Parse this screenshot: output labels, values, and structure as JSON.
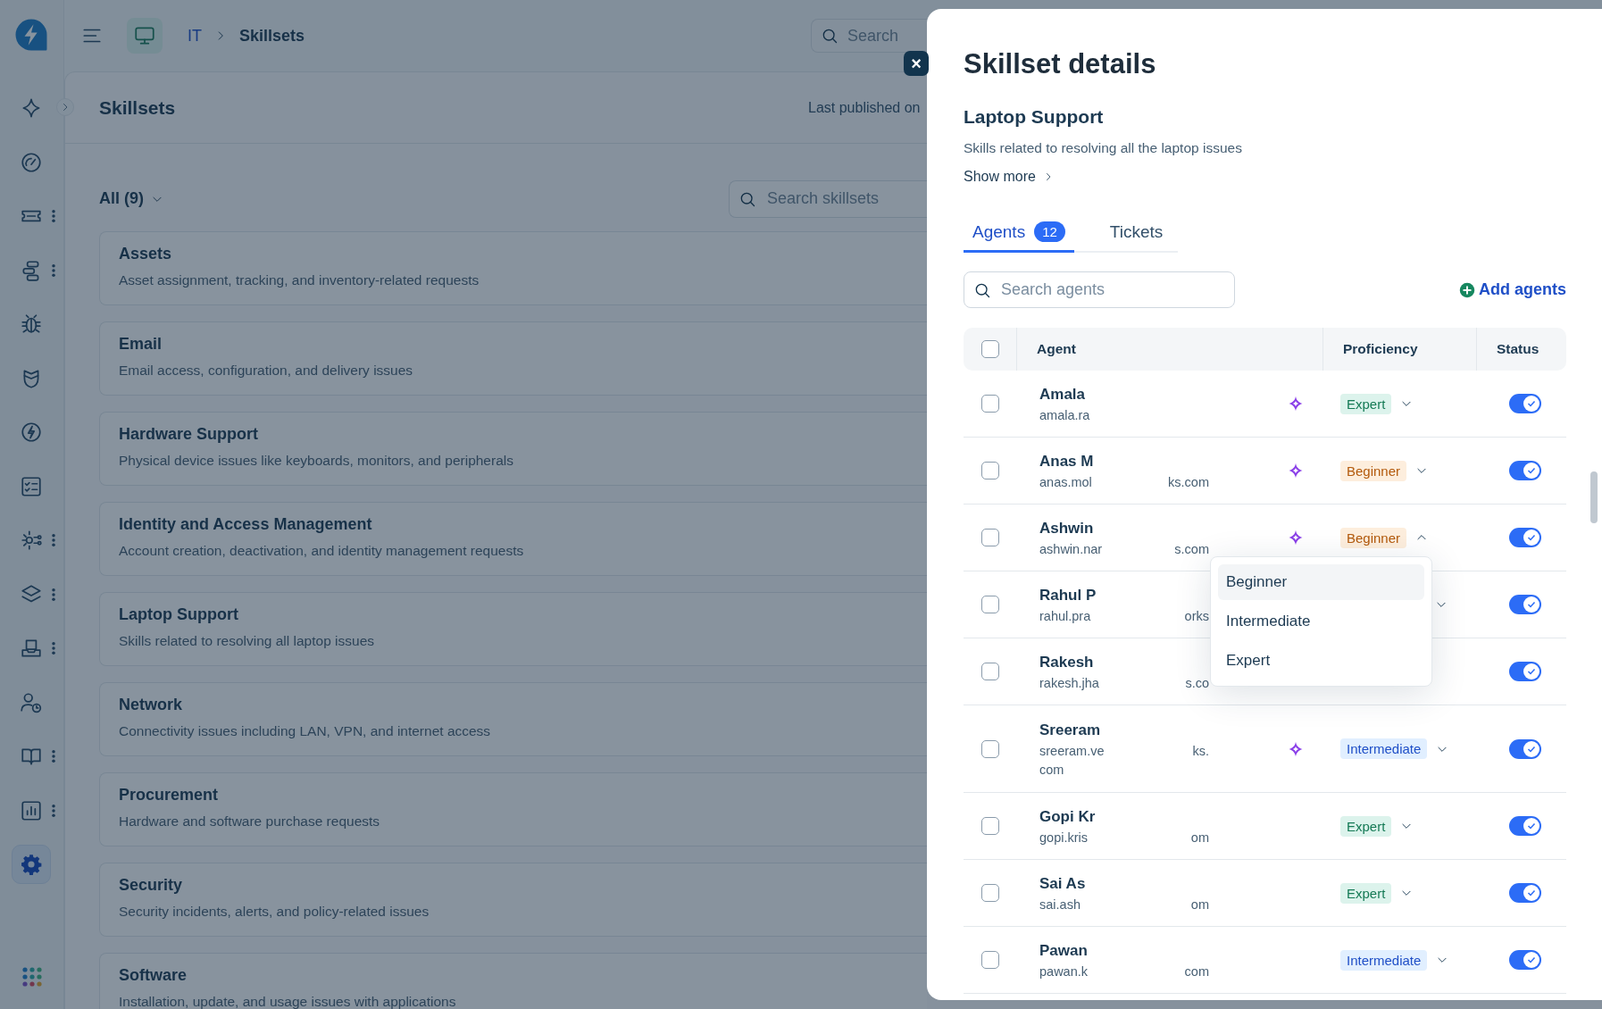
{
  "sidebar": {
    "items": [
      {
        "kind": "sparkle",
        "menu": false,
        "selected": false
      },
      {
        "kind": "gauge",
        "menu": false,
        "selected": false
      },
      {
        "kind": "ticket",
        "menu": true,
        "selected": false
      },
      {
        "kind": "flow",
        "menu": true,
        "selected": false
      },
      {
        "kind": "bug",
        "menu": false,
        "selected": false
      },
      {
        "kind": "shield",
        "menu": false,
        "selected": false
      },
      {
        "kind": "bolt",
        "menu": false,
        "selected": false
      },
      {
        "kind": "checklist",
        "menu": false,
        "selected": false
      },
      {
        "kind": "cog-nodes",
        "menu": true,
        "selected": false
      },
      {
        "kind": "layers",
        "menu": true,
        "selected": false
      },
      {
        "kind": "tray",
        "menu": true,
        "selected": false
      },
      {
        "kind": "user-clock",
        "menu": false,
        "selected": false
      },
      {
        "kind": "book",
        "menu": true,
        "selected": false
      },
      {
        "kind": "chart",
        "menu": true,
        "selected": false
      },
      {
        "kind": "settings",
        "menu": false,
        "selected": true
      }
    ]
  },
  "topbar": {
    "breadcrumb": [
      {
        "label": "IT",
        "kind": "link"
      },
      {
        "label": "Skillsets",
        "kind": "current"
      }
    ],
    "search": {
      "placeholder": "Search"
    }
  },
  "page": {
    "title": "Skillsets",
    "published": "Last published on",
    "filter": "All (9)",
    "search": {
      "placeholder": "Search skillsets"
    },
    "skillsets": [
      {
        "title": "Assets",
        "description": "Asset assignment, tracking, and inventory-related requests"
      },
      {
        "title": "Email",
        "description": "Email access, configuration, and delivery issues"
      },
      {
        "title": "Hardware Support",
        "description": "Physical device issues like keyboards, monitors, and peripherals"
      },
      {
        "title": "Identity and Access Management",
        "description": "Account creation, deactivation, and identity management requests"
      },
      {
        "title": "Laptop Support",
        "description": "Skills related to resolving all laptop issues"
      },
      {
        "title": "Network",
        "description": "Connectivity issues including LAN, VPN, and internet access"
      },
      {
        "title": "Procurement",
        "description": "Hardware and software purchase requests"
      },
      {
        "title": "Security",
        "description": "Security incidents, alerts, and policy-related issues"
      },
      {
        "title": "Software",
        "description": "Installation, update, and usage issues with applications"
      }
    ]
  },
  "panel": {
    "close": "×",
    "title": "Skillset details",
    "name": "Laptop Support",
    "description": "Skills related to resolving all the laptop issues",
    "show_more": "Show more",
    "tabs": [
      {
        "label": "Agents",
        "badge": "12",
        "selected": true
      },
      {
        "label": "Tickets",
        "selected": false
      }
    ],
    "search": {
      "placeholder": "Search agents"
    },
    "add": "Add agents",
    "select_all": {
      "checked": false
    },
    "columns": [
      "Agent",
      "Proficiency",
      "Status"
    ],
    "agents": [
      {
        "name": "Amala",
        "email_start": "amala.ra",
        "ai": true,
        "proficiency": {
          "label": "Expert",
          "kind": "expert"
        },
        "expanded": false,
        "checked": false,
        "on": true
      },
      {
        "name": "Anas M",
        "email_start": "anas.mol",
        "email_end": "ks.com",
        "ai": true,
        "proficiency": {
          "label": "Beginner",
          "kind": "beginner"
        },
        "expanded": false,
        "checked": false,
        "on": true
      },
      {
        "name": "Ashwin",
        "email_start": "ashwin.nar",
        "email_end": "s.com",
        "ai": true,
        "proficiency": {
          "label": "Beginner",
          "kind": "beginner"
        },
        "expanded": true,
        "checked": false,
        "on": true
      },
      {
        "name": "Rahul P",
        "email_start": "rahul.pra",
        "email_end": "orks",
        "ai": false,
        "expanded": false,
        "checked": false,
        "on": true
      },
      {
        "name": "Rakesh",
        "email_start": "rakesh.jha",
        "email_end": "s.co",
        "ai": false,
        "checked": false,
        "on": true
      },
      {
        "name": "Sreeram",
        "email_start": "sreeram.ve",
        "email_end": "ks.",
        "email_next": "com",
        "ai": true,
        "proficiency": {
          "label": "Intermediate",
          "kind": "intermediate"
        },
        "expanded": false,
        "checked": false,
        "on": true
      },
      {
        "name": "Gopi Kr",
        "email_start": "gopi.kris",
        "email_end": "om",
        "ai": false,
        "proficiency": {
          "label": "Expert",
          "kind": "expert"
        },
        "expanded": false,
        "checked": false,
        "on": true
      },
      {
        "name": "Sai As",
        "email_start": "sai.ash",
        "email_end": "om",
        "ai": false,
        "proficiency": {
          "label": "Expert",
          "kind": "expert"
        },
        "expanded": false,
        "checked": false,
        "on": true
      },
      {
        "name": "Pawan",
        "email_start": "pawan.k",
        "email_end": "com",
        "ai": false,
        "proficiency": {
          "label": "Intermediate",
          "kind": "intermediate"
        },
        "expanded": false,
        "checked": false,
        "on": true
      }
    ],
    "menu": {
      "options": [
        {
          "label": "Beginner",
          "selected": true
        },
        {
          "label": "Intermediate",
          "selected": false
        },
        {
          "label": "Expert",
          "selected": false
        }
      ]
    }
  }
}
